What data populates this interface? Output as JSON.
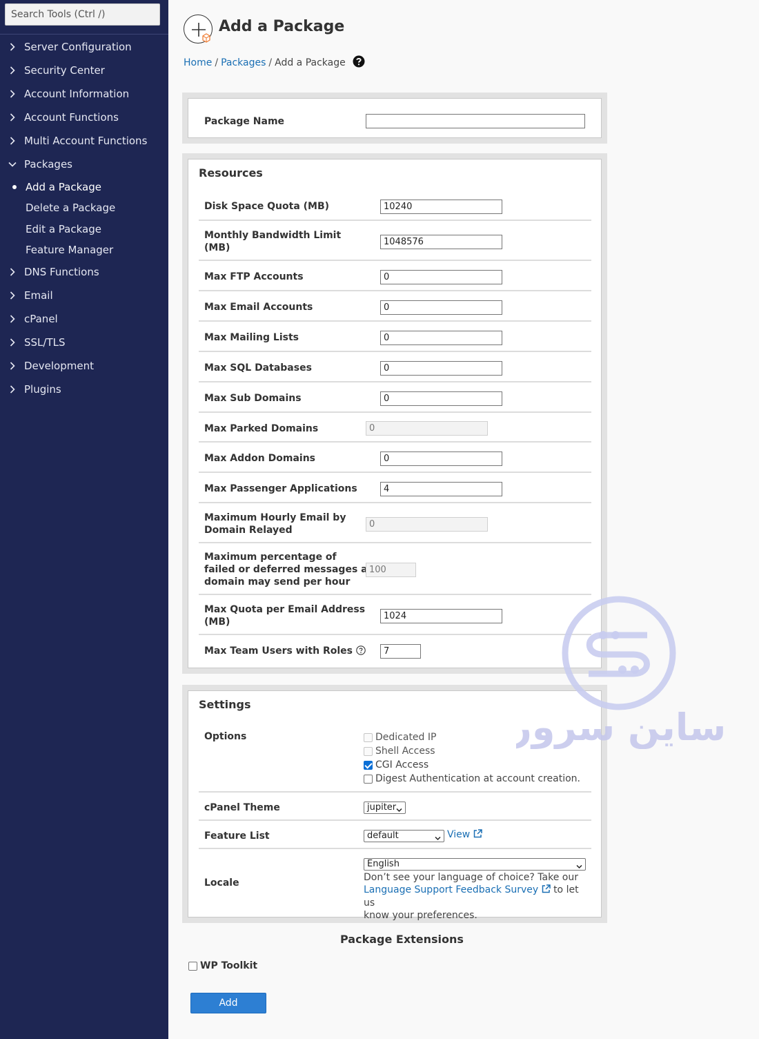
{
  "sidebar": {
    "search_placeholder": "Search Tools (Ctrl /)",
    "items": [
      {
        "label": "Server Configuration"
      },
      {
        "label": "Security Center"
      },
      {
        "label": "Account Information"
      },
      {
        "label": "Account Functions"
      },
      {
        "label": "Multi Account Functions"
      },
      {
        "label": "Packages"
      },
      {
        "label": "DNS Functions"
      },
      {
        "label": "Email"
      },
      {
        "label": "cPanel"
      },
      {
        "label": "SSL/TLS"
      },
      {
        "label": "Development"
      },
      {
        "label": "Plugins"
      }
    ],
    "packages_sub": [
      {
        "label": "Add a Package",
        "active": true
      },
      {
        "label": "Delete a Package"
      },
      {
        "label": "Edit a Package"
      },
      {
        "label": "Feature Manager"
      }
    ]
  },
  "page": {
    "title": "Add a Package",
    "breadcrumb": {
      "home": "Home",
      "packages": "Packages",
      "current": "Add a Package"
    }
  },
  "package_name": {
    "label": "Package Name",
    "value": ""
  },
  "resources": {
    "title": "Resources",
    "rows": [
      {
        "label": "Disk Space Quota (MB)",
        "value": "10240"
      },
      {
        "label_line1": "Monthly Bandwidth Limit",
        "label_line2": "(MB)",
        "value": "1048576"
      },
      {
        "label": "Max FTP Accounts",
        "value": "0"
      },
      {
        "label": "Max Email Accounts",
        "value": "0"
      },
      {
        "label": "Max Mailing Lists",
        "value": "0"
      },
      {
        "label": "Max SQL Databases",
        "value": "0"
      },
      {
        "label": "Max Sub Domains",
        "value": "0"
      },
      {
        "label": "Max Parked Domains",
        "value": "0"
      },
      {
        "label": "Max Addon Domains",
        "value": "0"
      },
      {
        "label": "Max Passenger Applications",
        "value": "4"
      },
      {
        "label_line1": "Maximum Hourly Email by",
        "label_line2": "Domain Relayed",
        "value": "0"
      },
      {
        "label_line1": "Maximum percentage of",
        "label_line2": "failed or deferred messages a",
        "label_line3": "domain may send per hour",
        "value": "100"
      },
      {
        "label_line1": "Max Quota per Email Address",
        "label_line2": "(MB)",
        "value": "1024"
      },
      {
        "label": "Max Team Users with Roles",
        "value": "7"
      }
    ]
  },
  "settings": {
    "title": "Settings",
    "options_label": "Options",
    "options": [
      {
        "label": "Dedicated IP",
        "checked": false,
        "disabled": true
      },
      {
        "label": "Shell Access",
        "checked": false,
        "disabled": true
      },
      {
        "label": "CGI Access",
        "checked": true,
        "disabled": false
      },
      {
        "label": "Digest Authentication at account creation.",
        "checked": false,
        "disabled": false
      }
    ],
    "theme_label": "cPanel Theme",
    "theme_value": "jupiter",
    "feature_list_label": "Feature List",
    "feature_list_value": "default",
    "view_link": "View",
    "locale_label": "Locale",
    "locale_value": "English",
    "locale_note_1": "Don’t see your language of choice? Take our",
    "locale_link": "Language Support Feedback Survey",
    "locale_note_2": "to let us",
    "locale_note_3": "know your preferences."
  },
  "extensions": {
    "title": "Package Extensions",
    "wp_toolkit": "WP Toolkit"
  },
  "add_button": "Add",
  "watermark_text": "ساین سرور",
  "colors": {
    "sidebar_bg": "#1e2653",
    "link": "#1a6fb4",
    "primary_button": "#2d7fd3"
  }
}
